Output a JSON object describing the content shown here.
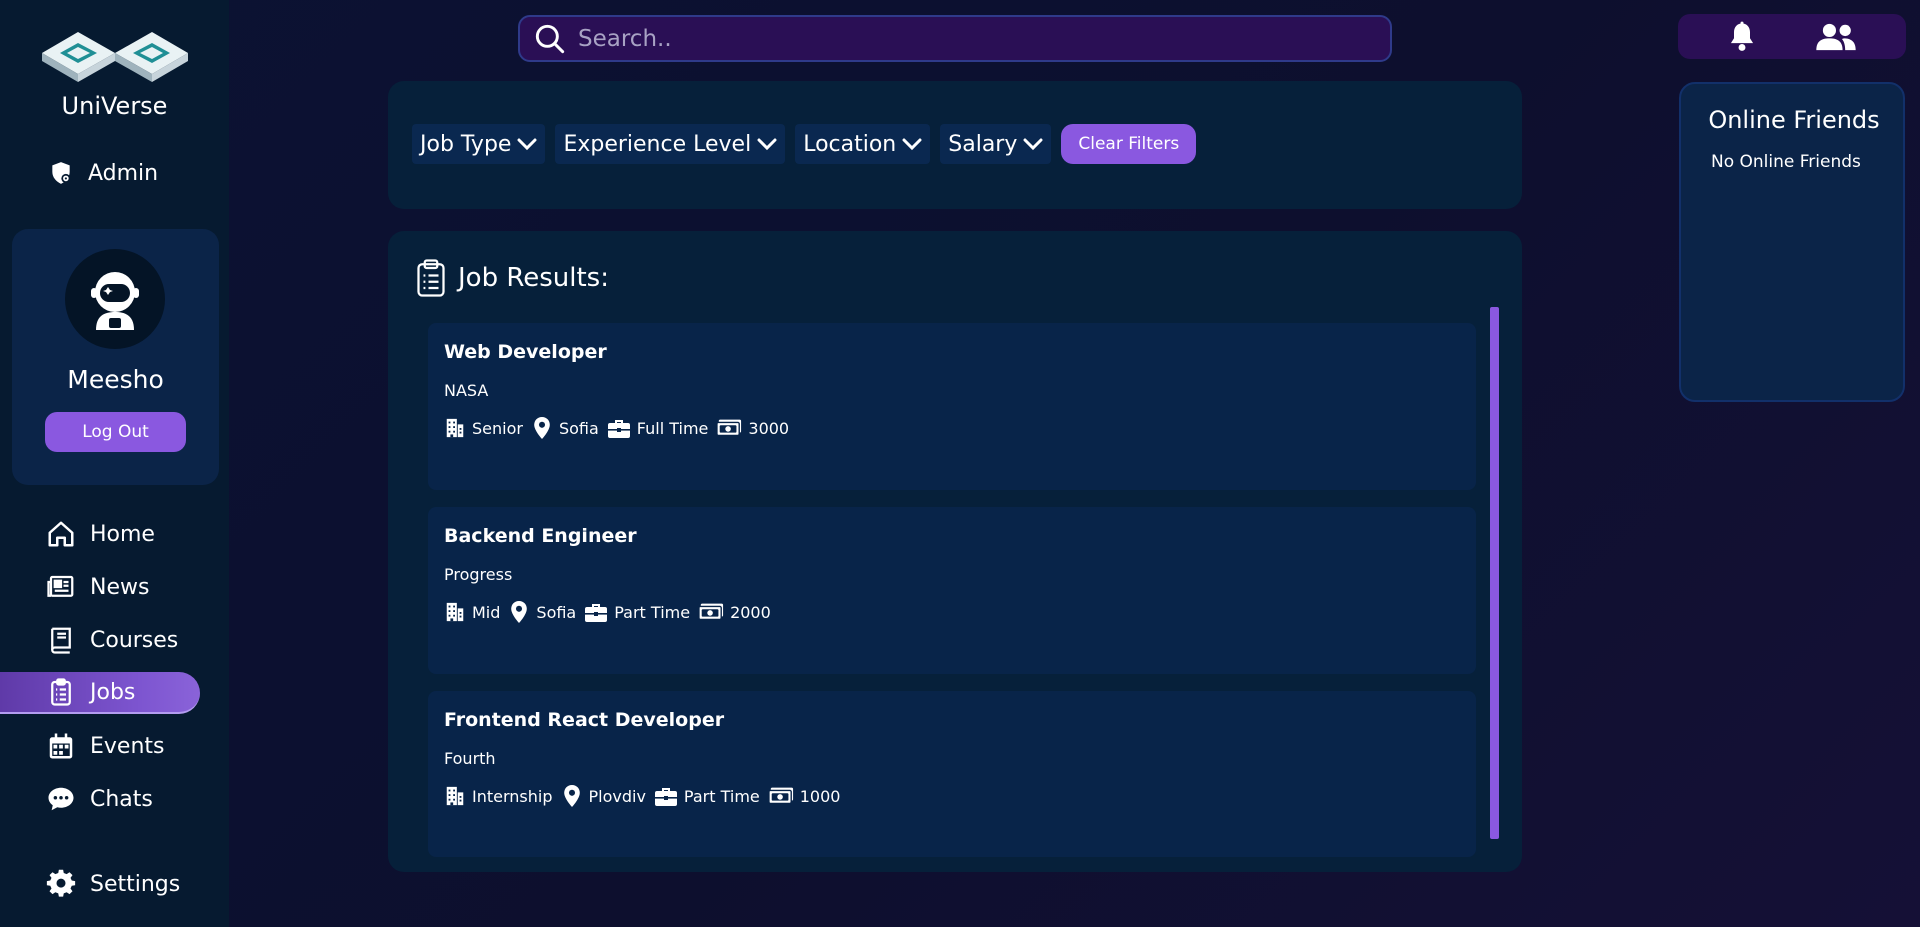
{
  "app": {
    "name": "UniVerse"
  },
  "sidebar": {
    "admin_label": "Admin",
    "user": {
      "name": "Meesho",
      "logout_label": "Log Out"
    },
    "nav": [
      {
        "label": "Home",
        "icon": "home-icon"
      },
      {
        "label": "News",
        "icon": "newspaper-icon"
      },
      {
        "label": "Courses",
        "icon": "book-icon"
      },
      {
        "label": "Jobs",
        "icon": "clipboard-icon",
        "active": true
      },
      {
        "label": "Events",
        "icon": "calendar-icon"
      },
      {
        "label": "Chats",
        "icon": "chat-bubble-icon"
      }
    ],
    "settings_label": "Settings"
  },
  "search": {
    "placeholder": "Search.."
  },
  "filters": {
    "job_type": "Job Type",
    "experience_level": "Experience Level",
    "location": "Location",
    "salary": "Salary",
    "clear_label": "Clear Filters"
  },
  "results": {
    "heading": "Job Results:",
    "jobs": [
      {
        "title": "Web Developer",
        "company": "NASA",
        "level": "Senior",
        "location": "Sofia",
        "type": "Full Time",
        "salary": "3000"
      },
      {
        "title": "Backend Engineer",
        "company": "Progress",
        "level": "Mid",
        "location": "Sofia",
        "type": "Part Time",
        "salary": "2000"
      },
      {
        "title": "Frontend React Developer",
        "company": "Fourth",
        "level": "Internship",
        "location": "Plovdiv",
        "type": "Part Time",
        "salary": "1000"
      }
    ]
  },
  "friends": {
    "title": "Online Friends",
    "empty_text": "No Online Friends"
  },
  "colors": {
    "accent": "#8a58e0",
    "sidebar_bg": "#061a30",
    "panel_bg": "#06203a",
    "card_bg": "#082449",
    "search_bg": "#2a0f55"
  }
}
